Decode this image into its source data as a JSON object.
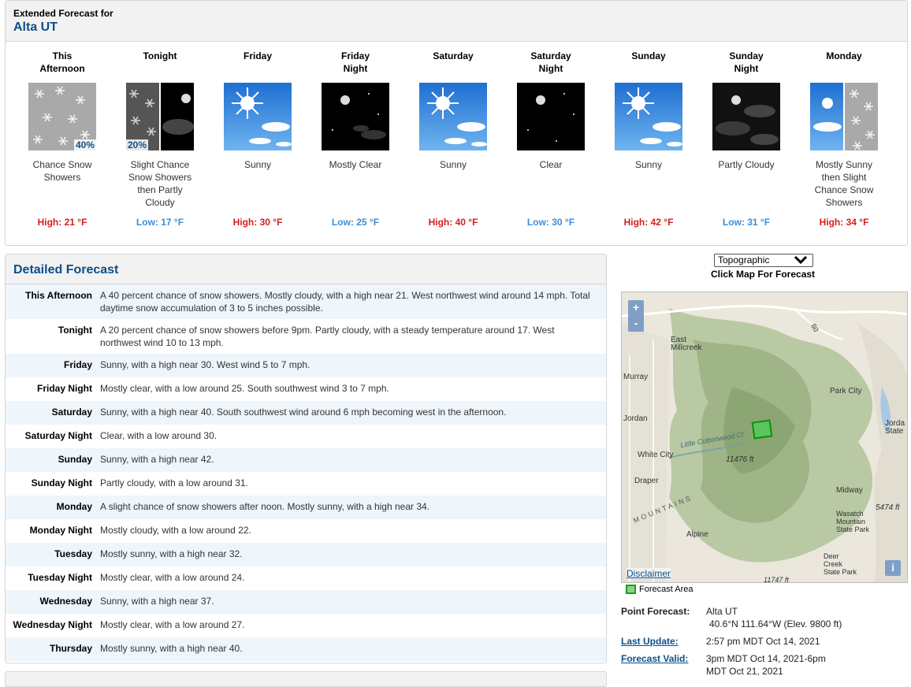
{
  "header": {
    "pre_title": "Extended Forecast for",
    "location": "Alta UT"
  },
  "periods": [
    {
      "name": "This\nAfternoon",
      "icon": "snow-showers-icon",
      "pop": "40%",
      "desc": "Chance Snow\nShowers",
      "temp": "High: 21 °F",
      "kind": "hi"
    },
    {
      "name": "Tonight",
      "icon": "snow-then-partly-cloudy-night-icon",
      "pop": "20%",
      "desc": "Slight Chance\nSnow Showers\nthen Partly\nCloudy",
      "temp": "Low: 17 °F",
      "kind": "lo"
    },
    {
      "name": "Friday",
      "icon": "sunny-icon",
      "pop": "",
      "desc": "Sunny",
      "temp": "High: 30 °F",
      "kind": "hi"
    },
    {
      "name": "Friday\nNight",
      "icon": "mostly-clear-night-icon",
      "pop": "",
      "desc": "Mostly Clear",
      "temp": "Low: 25 °F",
      "kind": "lo"
    },
    {
      "name": "Saturday",
      "icon": "sunny-icon",
      "pop": "",
      "desc": "Sunny",
      "temp": "High: 40 °F",
      "kind": "hi"
    },
    {
      "name": "Saturday\nNight",
      "icon": "clear-night-icon",
      "pop": "",
      "desc": "Clear",
      "temp": "Low: 30 °F",
      "kind": "lo"
    },
    {
      "name": "Sunday",
      "icon": "sunny-icon",
      "pop": "",
      "desc": "Sunny",
      "temp": "High: 42 °F",
      "kind": "hi"
    },
    {
      "name": "Sunday\nNight",
      "icon": "partly-cloudy-night-icon",
      "pop": "",
      "desc": "Partly Cloudy",
      "temp": "Low: 31 °F",
      "kind": "lo"
    },
    {
      "name": "Monday",
      "icon": "sunny-then-snow-icon",
      "pop": "",
      "desc": "Mostly Sunny\nthen Slight\nChance Snow\nShowers",
      "temp": "High: 34 °F",
      "kind": "hi"
    }
  ],
  "detailed": {
    "title": "Detailed Forecast",
    "rows": [
      {
        "label": "This Afternoon",
        "text": "A 40 percent chance of snow showers. Mostly cloudy, with a high near 21. West northwest wind around 14 mph. Total daytime snow accumulation of 3 to 5 inches possible."
      },
      {
        "label": "Tonight",
        "text": "A 20 percent chance of snow showers before 9pm. Partly cloudy, with a steady temperature around 17. West northwest wind 10 to 13 mph."
      },
      {
        "label": "Friday",
        "text": "Sunny, with a high near 30. West wind 5 to 7 mph."
      },
      {
        "label": "Friday Night",
        "text": "Mostly clear, with a low around 25. South southwest wind 3 to 7 mph."
      },
      {
        "label": "Saturday",
        "text": "Sunny, with a high near 40. South southwest wind around 6 mph becoming west in the afternoon."
      },
      {
        "label": "Saturday Night",
        "text": "Clear, with a low around 30."
      },
      {
        "label": "Sunday",
        "text": "Sunny, with a high near 42."
      },
      {
        "label": "Sunday Night",
        "text": "Partly cloudy, with a low around 31."
      },
      {
        "label": "Monday",
        "text": "A slight chance of snow showers after noon. Mostly sunny, with a high near 34."
      },
      {
        "label": "Monday Night",
        "text": "Mostly cloudy, with a low around 22."
      },
      {
        "label": "Tuesday",
        "text": "Mostly sunny, with a high near 32."
      },
      {
        "label": "Tuesday Night",
        "text": "Mostly clear, with a low around 24."
      },
      {
        "label": "Wednesday",
        "text": "Sunny, with a high near 37."
      },
      {
        "label": "Wednesday Night",
        "text": "Mostly clear, with a low around 27."
      },
      {
        "label": "Thursday",
        "text": "Mostly sunny, with a high near 40."
      }
    ]
  },
  "map": {
    "type_select": "Topographic",
    "click_hint": "Click Map For Forecast",
    "zoom_in": "+",
    "zoom_out": "-",
    "info": "i",
    "disclaimer": "Disclaimer",
    "legend": "Forecast Area",
    "labels": [
      "East\nMillcreek",
      "Murray",
      "Park City",
      "Jordan",
      "Jorda\nState",
      "White City",
      "11476 ft",
      "Draper",
      "Midway",
      "Wasatch\nMountain\nState Park",
      "5474 ft",
      "Alpine",
      "Deer\nCreek\nState Park",
      "Little Cottonwood Cr",
      "MOUNTAINS",
      "80",
      "11747 ft"
    ]
  },
  "point": {
    "label": "Point Forecast:",
    "name": "Alta UT",
    "coords": "40.6°N 111.64°W (Elev. 9800 ft)",
    "last_update_label": "Last Update:",
    "last_update": "2:57 pm MDT Oct 14, 2021",
    "valid_label": "Forecast Valid:",
    "valid": "3pm MDT Oct 14, 2021-6pm MDT Oct 21, 2021"
  },
  "colors": {
    "accent": "#0b4f8a",
    "high": "#d21f1f",
    "low": "#3b8ed8",
    "row_alt": "#eef5fb"
  }
}
